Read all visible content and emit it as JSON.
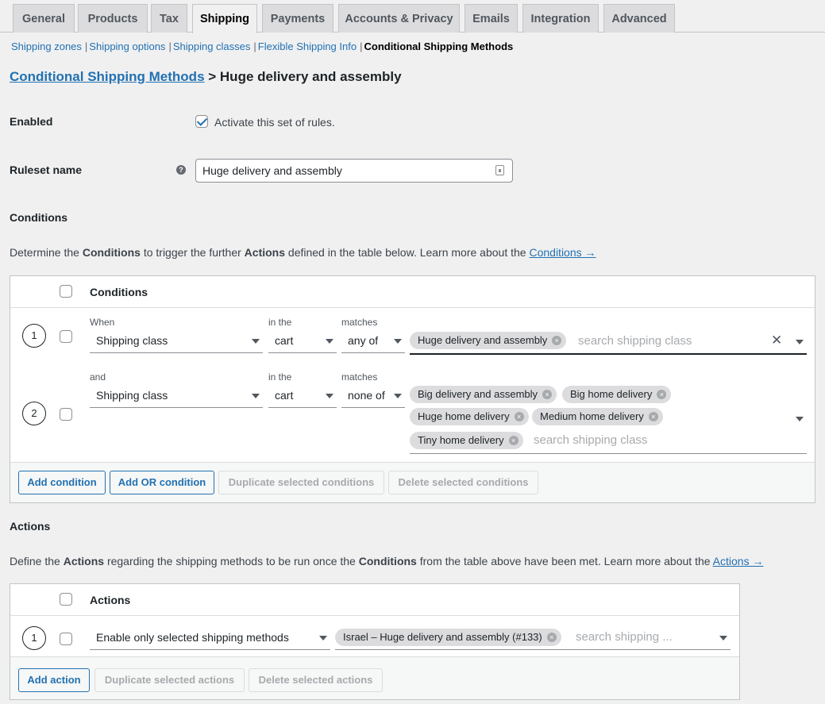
{
  "tabs": [
    {
      "label": "General"
    },
    {
      "label": "Products"
    },
    {
      "label": "Tax"
    },
    {
      "label": "Shipping"
    },
    {
      "label": "Payments"
    },
    {
      "label": "Accounts & Privacy"
    },
    {
      "label": "Emails"
    },
    {
      "label": "Integration"
    },
    {
      "label": "Advanced"
    }
  ],
  "active_tab": "Shipping",
  "subnav": {
    "items": [
      "Shipping zones",
      "Shipping options",
      "Shipping classes",
      "Flexible Shipping Info"
    ],
    "separator": "|",
    "current": "Conditional Shipping Methods"
  },
  "heading": {
    "link": "Conditional Shipping Methods",
    "rest": " > Huge delivery and assembly"
  },
  "enabled": {
    "label": "Enabled",
    "checkbox_label": "Activate this set of rules.",
    "checked": true
  },
  "ruleset": {
    "label": "Ruleset name",
    "help": "?",
    "value": "Huge delivery and assembly"
  },
  "conditions": {
    "section_title": "Conditions",
    "desc_1": "Determine the ",
    "desc_b1": "Conditions",
    "desc_2": " to trigger the further ",
    "desc_b2": "Actions",
    "desc_3": " defined in the table below. Learn more about the ",
    "desc_link": "Conditions →",
    "column_header": "Conditions",
    "rows": [
      {
        "number": "1",
        "prefix": "When",
        "field": "Shipping class",
        "in_label": "in the",
        "in_value": "cart",
        "matches_label": "matches",
        "matches_value": "any of",
        "tags": [
          "Huge delivery and assembly"
        ],
        "placeholder": "search shipping class"
      },
      {
        "number": "2",
        "prefix": "and",
        "field": "Shipping class",
        "in_label": "in the",
        "in_value": "cart",
        "matches_label": "matches",
        "matches_value": "none of",
        "tags": [
          "Big delivery and assembly",
          "Big home delivery",
          "Huge home delivery",
          "Medium home delivery",
          "Tiny home delivery"
        ],
        "placeholder": "search shipping class"
      }
    ],
    "buttons": {
      "add": "Add condition",
      "add_or": "Add OR condition",
      "duplicate": "Duplicate selected conditions",
      "delete": "Delete selected conditions"
    }
  },
  "actions": {
    "section_title": "Actions",
    "desc_1": "Define the ",
    "desc_b1": "Actions",
    "desc_2": " regarding the shipping methods to be run once the ",
    "desc_b2": "Conditions",
    "desc_3": " from the table above have been met. Learn more about the ",
    "desc_link": "Actions →",
    "column_header": "Actions",
    "rows": [
      {
        "number": "1",
        "action": "Enable only selected shipping methods",
        "tags": [
          "Israel – Huge delivery and assembly (#133)"
        ],
        "placeholder": "search shipping ..."
      }
    ],
    "buttons": {
      "add": "Add action",
      "duplicate": "Duplicate selected actions",
      "delete": "Delete selected actions"
    }
  },
  "icons": {
    "remove_tag": "×",
    "clear": "✕"
  },
  "colors": {
    "link": "#2271b1",
    "background": "#f0f0f1",
    "tag": "#dcdcde"
  }
}
